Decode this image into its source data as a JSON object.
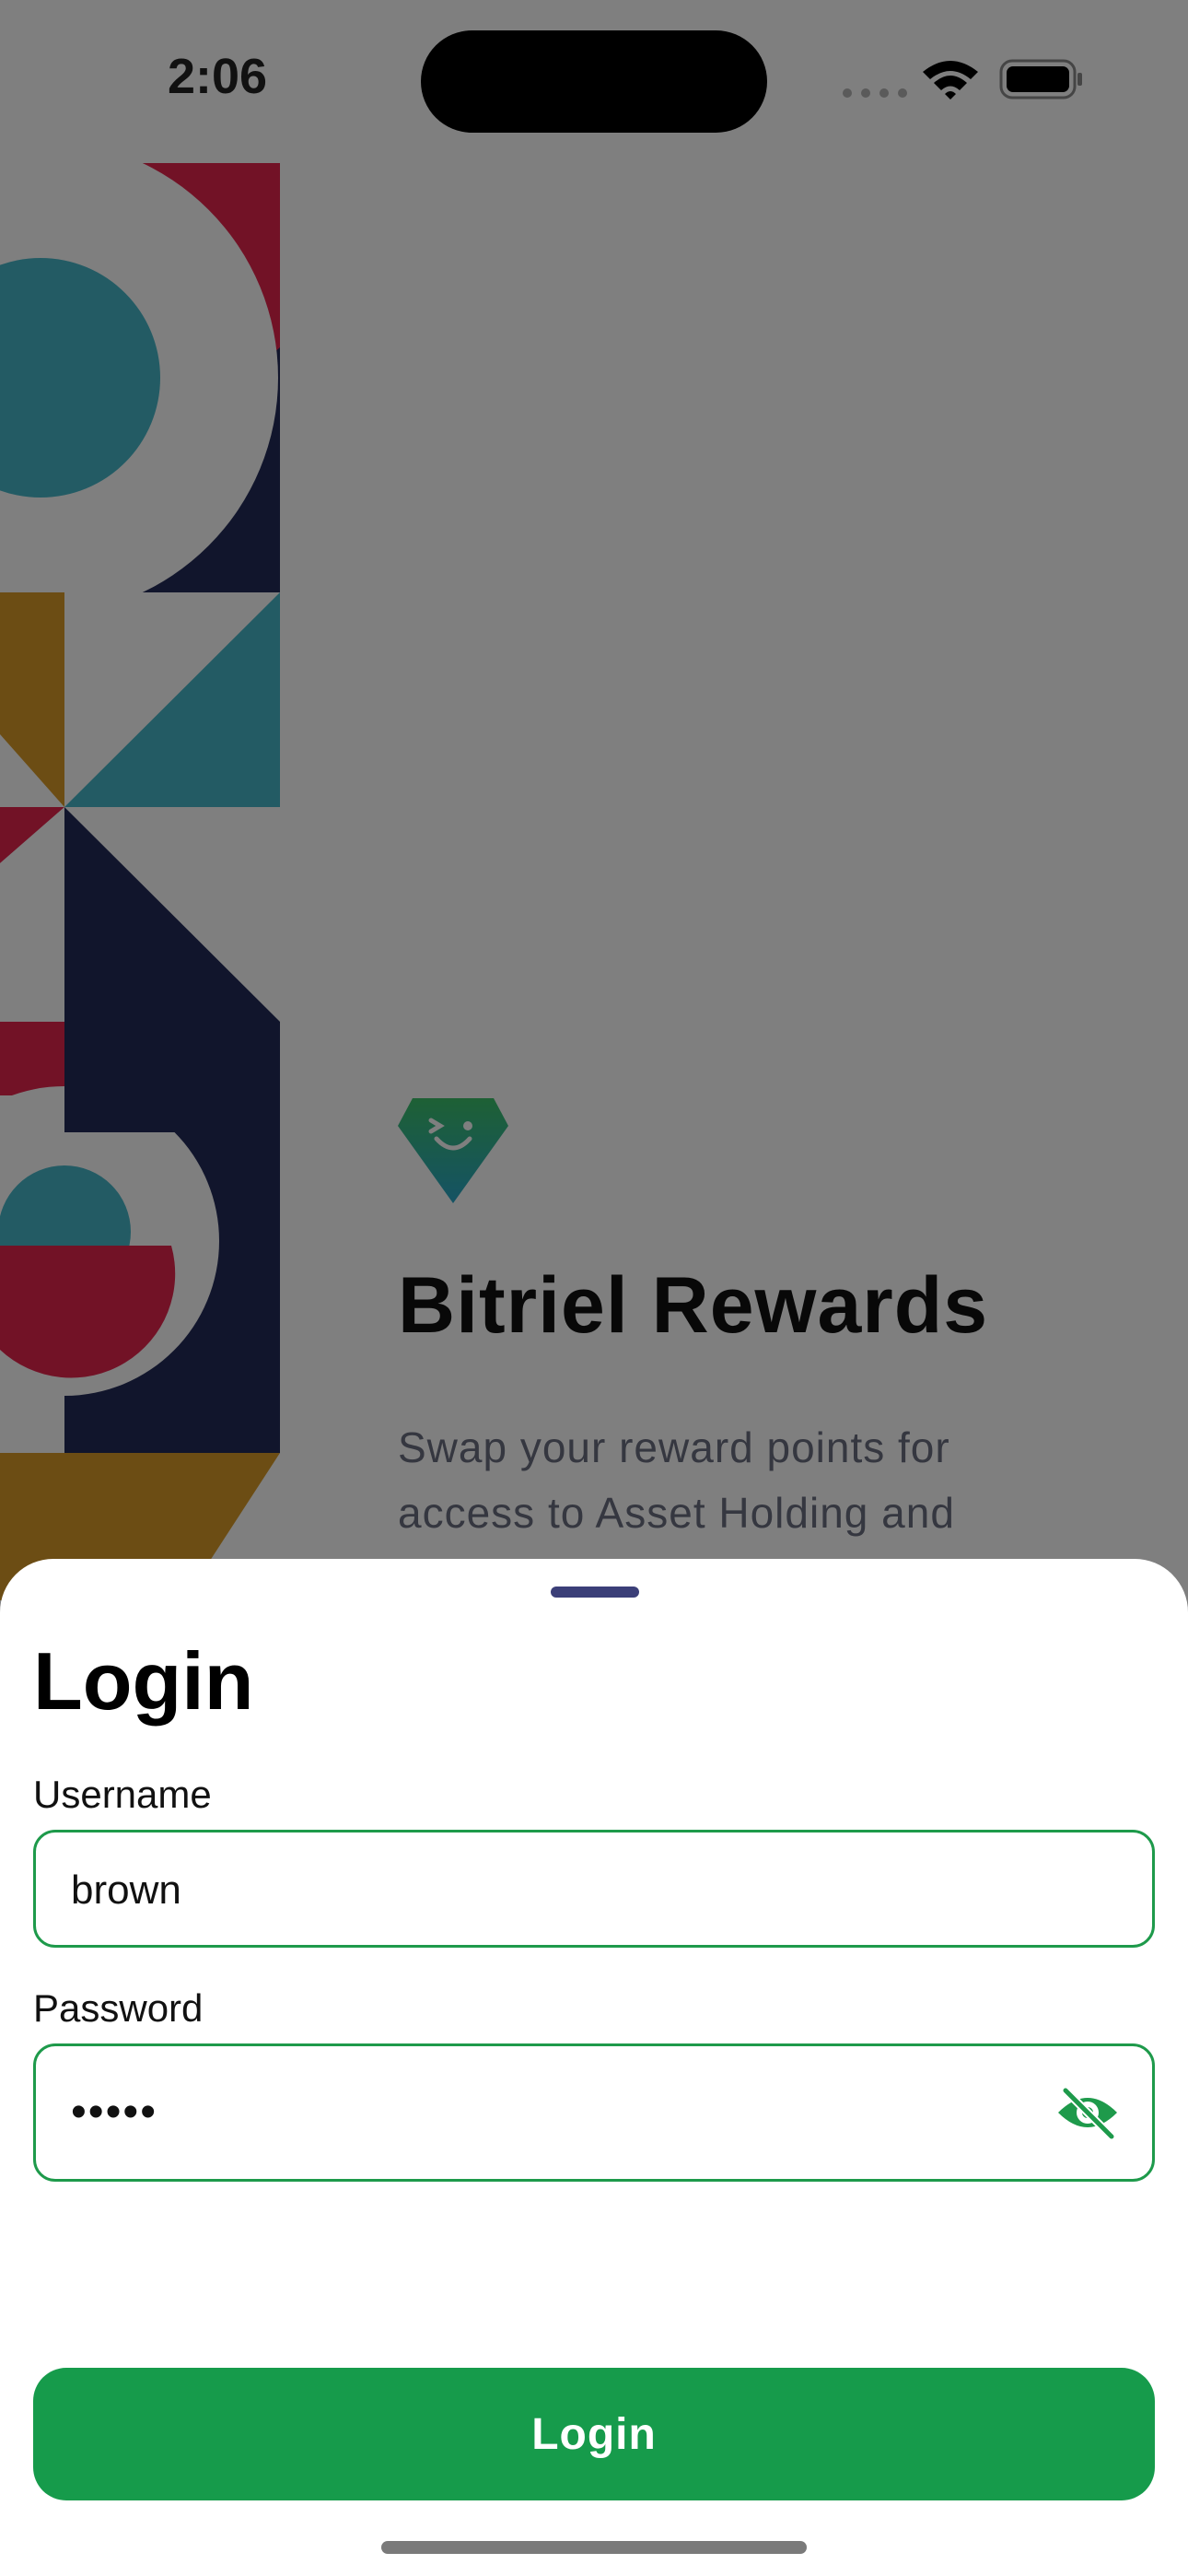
{
  "status_bar": {
    "time": "2:06"
  },
  "onboarding": {
    "title": "Bitriel Rewards",
    "description": "Swap your reward points for access to Asset Holding and"
  },
  "login_sheet": {
    "title": "Login",
    "username": {
      "label": "Username",
      "value": "brown"
    },
    "password": {
      "label": "Password",
      "masked_value": "•••••"
    },
    "submit_label": "Login"
  },
  "icons": {
    "brand": "diamond-smile-logo-icon",
    "visibility": "eye-slash-icon",
    "wifi": "wifi-icon",
    "battery": "battery-icon",
    "signal": "cellular-signal-icon"
  },
  "colors": {
    "accent": "#169b4b",
    "field_border": "#1e9a4b",
    "grabber": "#3b3f78",
    "art_crimson": "#e4244d",
    "art_teal": "#46b7c9",
    "art_navy": "#232a58",
    "art_mustard": "#d99b29"
  }
}
